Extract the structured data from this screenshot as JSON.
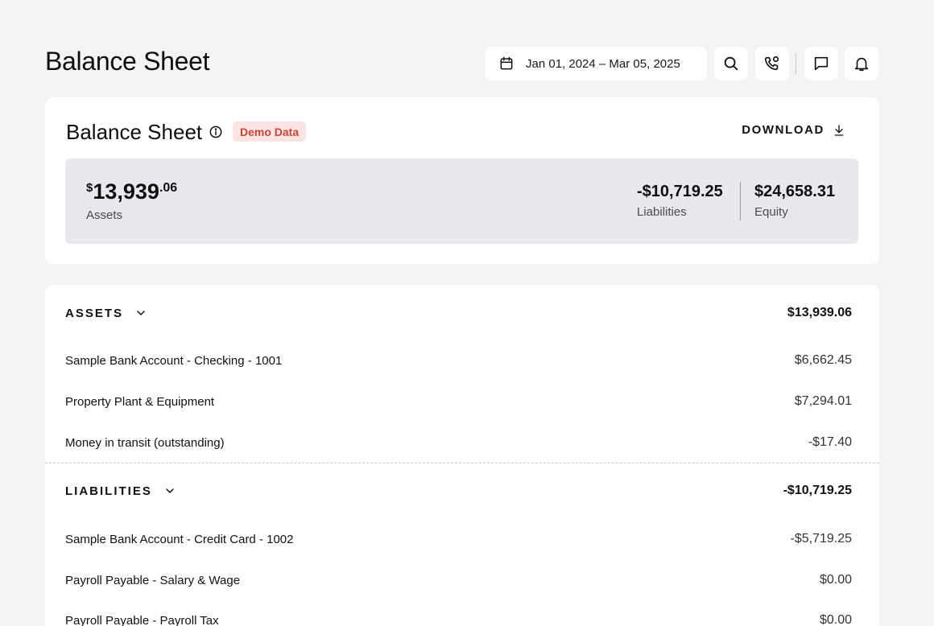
{
  "header": {
    "title": "Balance Sheet",
    "date_range": "Jan 01, 2024 – Mar 05, 2025"
  },
  "card": {
    "title": "Balance Sheet",
    "badge": "Demo Data",
    "download_label": "DOWNLOAD",
    "summary": {
      "assets_currency": "$",
      "assets_whole": "13,939",
      "assets_cents": ".06",
      "assets_label": "Assets",
      "liabilities_value": "-$10,719.25",
      "liabilities_label": "Liabilities",
      "equity_value": "$24,658.31",
      "equity_label": "Equity"
    }
  },
  "sections": {
    "assets": {
      "name": "ASSETS",
      "total": "$13,939.06",
      "rows": [
        {
          "label": "Sample Bank Account - Checking - 1001",
          "amount": "$6,662.45"
        },
        {
          "label": "Property Plant & Equipment",
          "amount": "$7,294.01"
        },
        {
          "label": "Money in transit (outstanding)",
          "amount": "-$17.40"
        }
      ]
    },
    "liabilities": {
      "name": "LIABILITIES",
      "total": "-$10,719.25",
      "rows": [
        {
          "label": "Sample Bank Account - Credit Card - 1002",
          "amount": "-$5,719.25"
        },
        {
          "label": "Payroll Payable - Salary & Wage",
          "amount": "$0.00"
        },
        {
          "label": "Payroll Payable - Payroll Tax",
          "amount": "$0.00"
        }
      ]
    }
  },
  "icons": {
    "calendar": "calendar-icon",
    "search": "search-icon",
    "phone": "phone-icon",
    "chat": "chat-icon",
    "bell": "bell-icon",
    "info": "info-icon",
    "download": "download-icon",
    "chevron": "chevron-down-icon"
  },
  "colors": {
    "badge_bg": "#fbe4e1",
    "badge_text": "#c6453a",
    "page_bg": "#f4f4f5"
  }
}
